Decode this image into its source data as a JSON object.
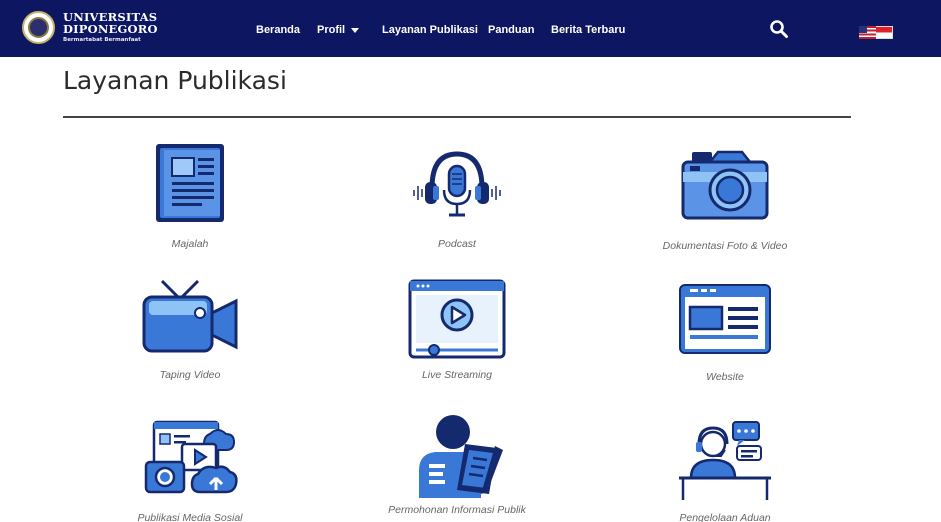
{
  "header": {
    "brand_line1": "UNIVERSITAS",
    "brand_line2": "DIPONEGORO",
    "brand_tagline": "Bermartabat Bermanfaat",
    "nav": [
      {
        "label": "Beranda"
      },
      {
        "label": "Profil"
      },
      {
        "label": "Layanan Publikasi"
      },
      {
        "label": "Panduan"
      },
      {
        "label": "Berita Terbaru"
      }
    ],
    "search_icon": "search-icon",
    "language_flags": [
      "us-flag-icon",
      "indonesia-flag-icon"
    ]
  },
  "main": {
    "title": "Layanan Publikasi",
    "services": [
      {
        "label": "Majalah",
        "icon": "newspaper-icon"
      },
      {
        "label": "Podcast",
        "icon": "podcast-microphone-icon"
      },
      {
        "label": "Dokumentasi Foto & Video",
        "icon": "camera-icon"
      },
      {
        "label": "Taping Video",
        "icon": "video-camera-icon"
      },
      {
        "label": "Live Streaming",
        "icon": "live-stream-player-icon"
      },
      {
        "label": "Website",
        "icon": "website-icon"
      },
      {
        "label": "Publikasi Media Sosial",
        "icon": "social-media-icon"
      },
      {
        "label": "Permohonan Informasi Publik",
        "icon": "information-request-icon"
      },
      {
        "label": "Pengelolaan Aduan",
        "icon": "complaint-support-icon"
      }
    ]
  },
  "colors": {
    "header_bg": "#0d1660",
    "icon_primary": "#3a78d8",
    "icon_dark": "#152a6e",
    "icon_light": "#8fc3f5"
  }
}
